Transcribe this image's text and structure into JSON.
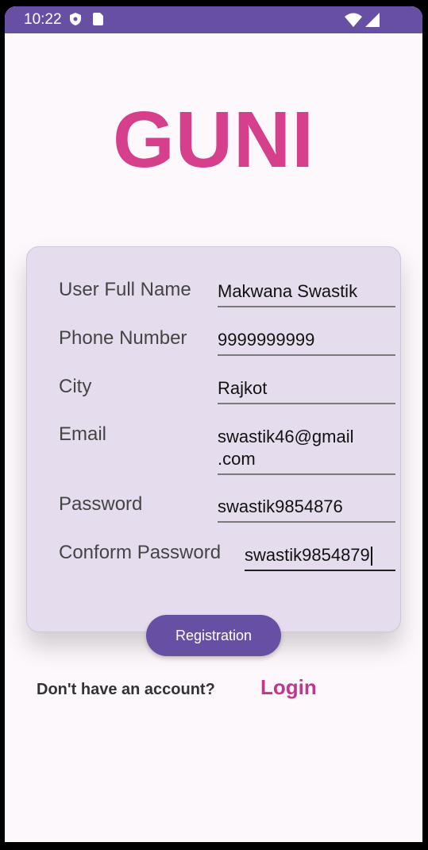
{
  "status_bar": {
    "time": "10:22",
    "icons": [
      "shield-icon",
      "sim-card-icon",
      "wifi-icon",
      "signal-icon"
    ],
    "background": "#6750a4"
  },
  "logo": {
    "text": "GUNI",
    "color": "#d53f8c"
  },
  "form": {
    "fields": [
      {
        "label": "User Full Name",
        "value": "Makwana Swastik"
      },
      {
        "label": "Phone Number",
        "value": "9999999999"
      },
      {
        "label": "City",
        "value": "Rajkot"
      },
      {
        "label": "Email",
        "value_line1": "swastik46@gmail",
        "value_line2": ".com"
      },
      {
        "label": "Password",
        "value": "swastik9854876"
      },
      {
        "label": "Conform Password",
        "value": "swastik9854879"
      }
    ],
    "card_color": "#e5ddee"
  },
  "actions": {
    "registration_label": "Registration",
    "no_account_text": "Don't have an account?",
    "login_label": "Login",
    "accent": "#6750a4",
    "login_color": "#c2378a"
  }
}
